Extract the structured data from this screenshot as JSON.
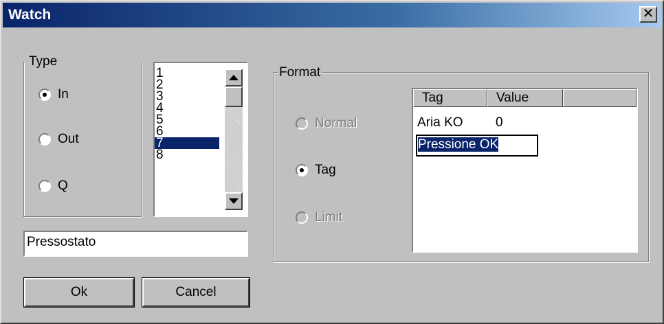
{
  "window": {
    "title": "Watch",
    "close_icon": "close-icon"
  },
  "type_group": {
    "label": "Type",
    "options": [
      {
        "label": "In",
        "selected": true
      },
      {
        "label": "Out",
        "selected": false
      },
      {
        "label": "Q",
        "selected": false
      }
    ]
  },
  "number_list": {
    "items": [
      "1",
      "2",
      "3",
      "4",
      "5",
      "6",
      "7",
      "8"
    ],
    "selected": "7"
  },
  "name_field": {
    "value": "Pressostato"
  },
  "buttons": {
    "ok": "Ok",
    "cancel": "Cancel"
  },
  "format_group": {
    "label": "Format",
    "options": [
      {
        "label": "Normal",
        "selected": false,
        "enabled": false
      },
      {
        "label": "Tag",
        "selected": true,
        "enabled": true
      },
      {
        "label": "Limit",
        "selected": false,
        "enabled": false
      }
    ]
  },
  "tag_grid": {
    "columns": [
      "Tag",
      "Value"
    ],
    "rows": [
      {
        "tag": "Aria KO",
        "value": "0"
      }
    ],
    "editing_value": "Pressione OK"
  },
  "colors": {
    "selection": "#0a246a",
    "face": "#c0c0c0"
  }
}
